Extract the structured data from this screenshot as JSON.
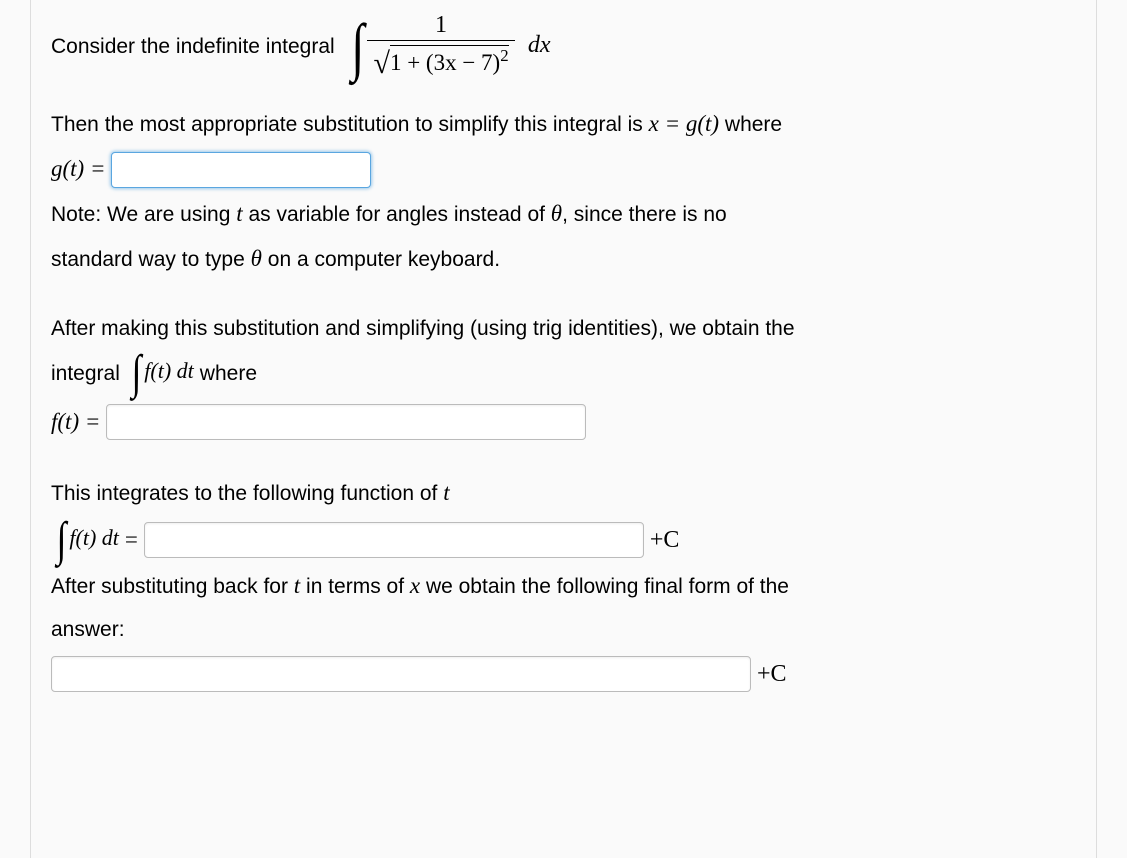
{
  "intro": {
    "text": "Consider the indefinite integral",
    "integral": {
      "numerator": "1",
      "denominator_inside": "1 + (3x − 7)",
      "denominator_exp": "2",
      "diff": "dx"
    }
  },
  "substitution": {
    "prompt_part1": "Then the most appropriate substitution to simplify this integral is ",
    "eq": "x = g(t)",
    "where": " where",
    "label": "g(t) =",
    "input_value": ""
  },
  "note": {
    "line1_a": "Note: We are using ",
    "line1_var": "t",
    "line1_b": " as variable for angles instead of ",
    "line1_theta": "θ",
    "line1_c": ", since there is no",
    "line2_a": "standard way to type ",
    "line2_theta": "θ",
    "line2_b": " on a computer keyboard."
  },
  "after_sub": {
    "line1": "After making this substitution and simplifying (using trig identities), we obtain the",
    "line2_a": "integral",
    "ft_dt": "f(t) dt",
    "line2_b": " where",
    "label": "f(t) =",
    "input_value": ""
  },
  "integrate": {
    "prompt_a": "This integrates to the following function of ",
    "var_t": "t",
    "label": "f(t) dt",
    "equals": " =",
    "plus_c": "+C",
    "input_value": ""
  },
  "back_sub": {
    "line_a": "After substituting back for ",
    "var_t": "t",
    "line_b": " in terms of ",
    "var_x": "x",
    "line_c": " we obtain the following final form of the",
    "line2": "answer:",
    "plus_c": "+C",
    "input_value": ""
  }
}
